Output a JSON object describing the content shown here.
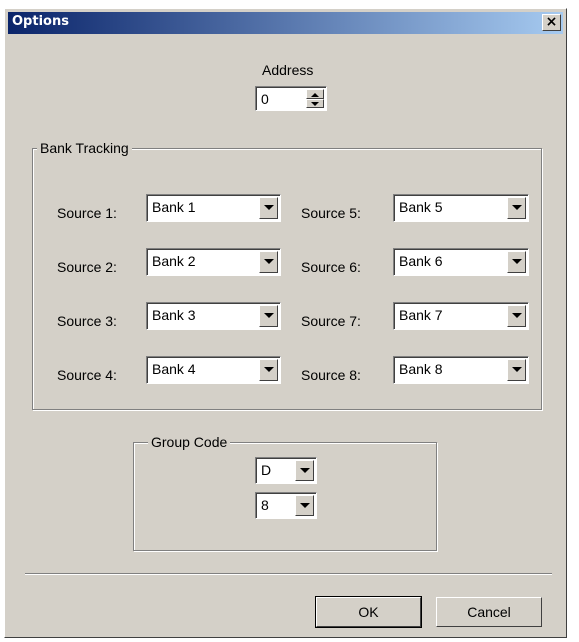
{
  "window": {
    "title": "Options",
    "close_glyph": "×"
  },
  "address": {
    "label": "Address",
    "value": "0"
  },
  "bank_tracking": {
    "title": "Bank Tracking",
    "sources": [
      {
        "label": "Source 1:",
        "value": "Bank 1"
      },
      {
        "label": "Source 2:",
        "value": "Bank 2"
      },
      {
        "label": "Source 3:",
        "value": "Bank 3"
      },
      {
        "label": "Source 4:",
        "value": "Bank 4"
      },
      {
        "label": "Source 5:",
        "value": "Bank 5"
      },
      {
        "label": "Source 6:",
        "value": "Bank 6"
      },
      {
        "label": "Source 7:",
        "value": "Bank 7"
      },
      {
        "label": "Source 8:",
        "value": "Bank 8"
      }
    ]
  },
  "group_code": {
    "title": "Group Code",
    "letter": "D",
    "number": "8"
  },
  "buttons": {
    "ok": "OK",
    "cancel": "Cancel"
  },
  "colors": {
    "face": "#d4d0c8",
    "title_start": "#0a246a",
    "title_end": "#a6caf0"
  }
}
